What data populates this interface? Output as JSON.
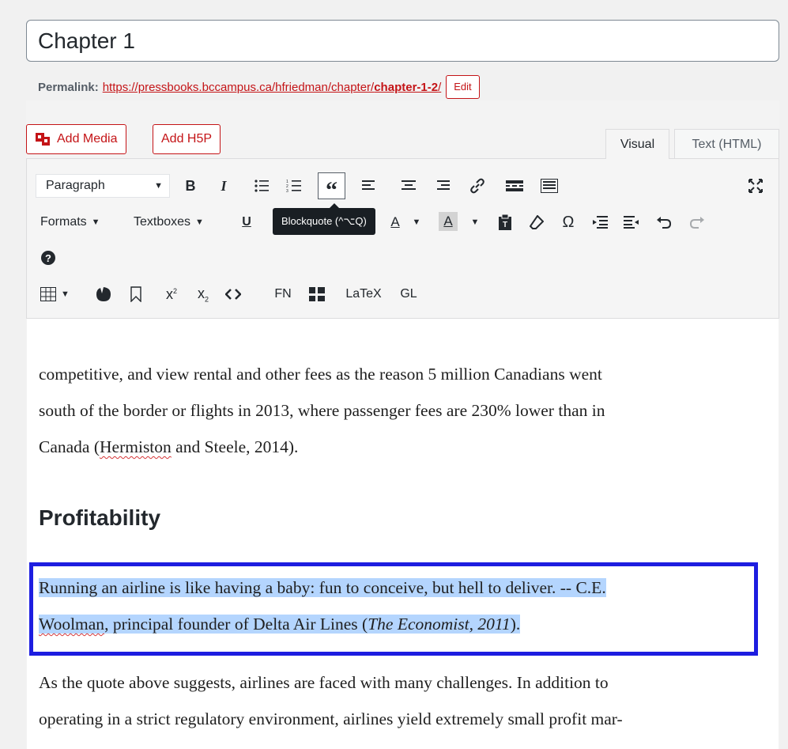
{
  "title": "Chapter 1",
  "permalink": {
    "label": "Permalink:",
    "url_prefix": "https://pressbooks.bccampus.ca/hfriedman/chapter/",
    "url_slug": "chapter-1-2",
    "url_suffix": "/",
    "edit_label": "Edit"
  },
  "media_buttons": {
    "add_media": "Add Media",
    "add_h5p": "Add H5P"
  },
  "tabs": {
    "visual": "Visual",
    "text": "Text (HTML)"
  },
  "toolbar": {
    "paragraph_select": "Paragraph",
    "bold": "B",
    "italic": "I",
    "underline": "U",
    "formats": "Formats",
    "textboxes": "Textboxes",
    "omega": "Ω",
    "font_color_a": "A",
    "bg_color_a": "A",
    "fn": "FN",
    "latex": "LaTeX",
    "gl": "GL",
    "tooltip": "Blockquote (^⌥Q)"
  },
  "content": {
    "p1_lines": [
      "competitive, and view rental and other fees as the reason 5 million Canadians went",
      "south of the border or flights in 2013, where passenger fees are 230% lower than in"
    ],
    "p1_line3_pre": "Canada (",
    "p1_line3_miss": "Hermiston",
    "p1_line3_post": " and Steele, 2014).",
    "heading": "Profitability",
    "quote_line1": "Running an airline is like having a baby: fun to conceive, but hell to deliver. -- C.E.",
    "quote_line2_miss": "Woolman",
    "quote_line2_mid": ", principal founder of Delta Air Lines (",
    "quote_line2_ital": "The Economist, 2011",
    "quote_line2_end": ").",
    "p3_lines": [
      "As the quote above suggests, airlines are faced with many challenges. In addition to",
      "operating in a strict regulatory environment, airlines yield extremely small profit mar-"
    ]
  },
  "colors": {
    "accent": "#c41417",
    "selection_border": "#1d1de0",
    "selection_fill": "#b4d5fe"
  }
}
